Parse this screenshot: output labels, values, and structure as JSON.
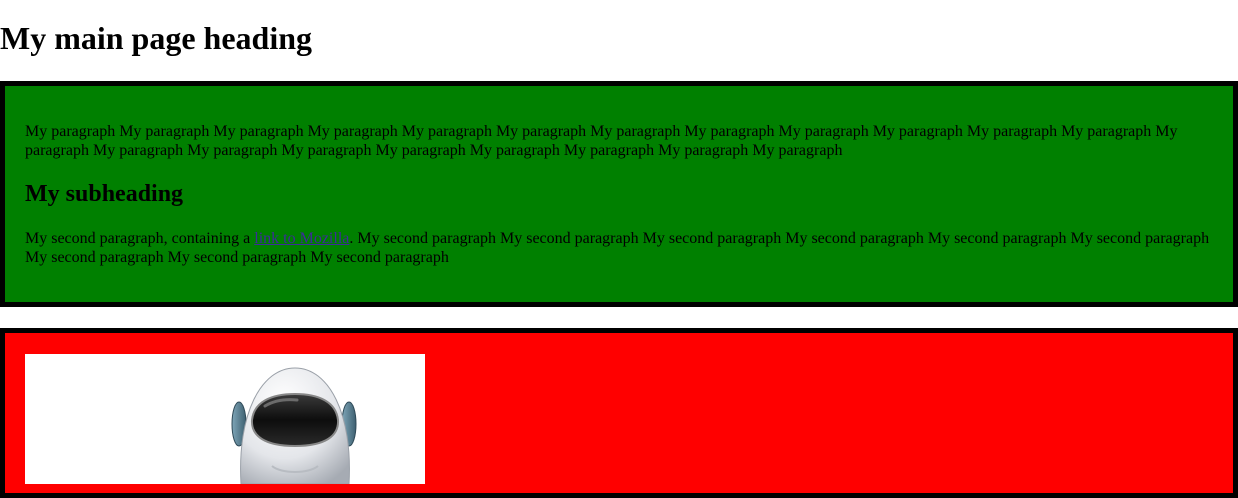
{
  "page": {
    "heading": "My main page heading"
  },
  "section_one": {
    "background_color": "#008000",
    "paragraph_1": "My paragraph My paragraph My paragraph My paragraph My paragraph My paragraph My paragraph My paragraph My paragraph My paragraph My paragraph My paragraph My paragraph My paragraph My paragraph My paragraph My paragraph My paragraph My paragraph My paragraph My paragraph",
    "subheading": "My subheading",
    "paragraph_2_before": "My second paragraph, containing a ",
    "link_text": "link to Mozilla",
    "paragraph_2_after": ". My second paragraph My second paragraph My second paragraph My second paragraph My second paragraph My second paragraph My second paragraph My second paragraph My second paragraph"
  },
  "section_two": {
    "background_color": "#ff0000",
    "image_icon": "robot-head-icon"
  }
}
